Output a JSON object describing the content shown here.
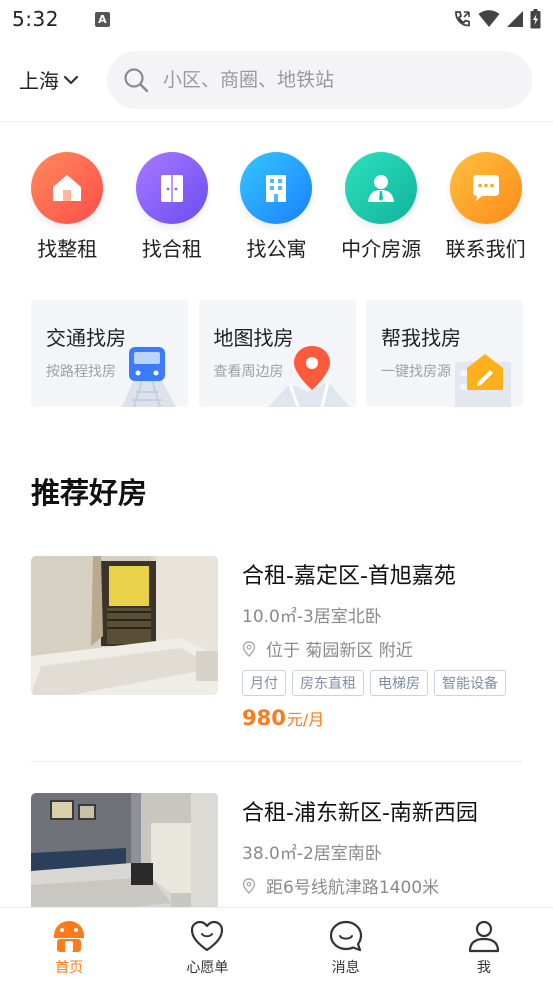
{
  "status": {
    "time": "5:32",
    "app_badge": "A"
  },
  "header": {
    "city": "上海",
    "search_placeholder": "小区、商圈、地铁站"
  },
  "categories": [
    {
      "label": "找整租",
      "icon": "house-icon",
      "color": "#ff5d4a"
    },
    {
      "label": "找合租",
      "icon": "door-icon",
      "color": "#8b5cf6"
    },
    {
      "label": "找公寓",
      "icon": "building-icon",
      "color": "#1aa3ff"
    },
    {
      "label": "中介房源",
      "icon": "agent-icon",
      "color": "#14c6a9"
    },
    {
      "label": "联系我们",
      "icon": "chat-bubble-icon",
      "color": "#ffa51a"
    }
  ],
  "finds": [
    {
      "title": "交通找房",
      "subtitle": "按路程找房",
      "icon": "train-icon"
    },
    {
      "title": "地图找房",
      "subtitle": "查看周边房",
      "icon": "map-pin-icon"
    },
    {
      "title": "帮我找房",
      "subtitle": "一键找房源",
      "icon": "edit-house-icon"
    }
  ],
  "section_title": "推荐好房",
  "listings": [
    {
      "title": "合租-嘉定区-首旭嘉苑",
      "spec": "10.0㎡-3居室北卧",
      "location": "位于 菊园新区 附近",
      "tags": [
        "月付",
        "房东直租",
        "电梯房",
        "智能设备"
      ],
      "price": "980",
      "price_unit": "元/月"
    },
    {
      "title": "合租-浦东新区-南新西园",
      "spec": "38.0㎡-2居室南卧",
      "location": "距6号线航津路1400米",
      "tags": [
        "",
        "",
        "",
        ""
      ]
    }
  ],
  "nav": [
    {
      "label": "首页",
      "icon": "home-icon",
      "active": true
    },
    {
      "label": "心愿单",
      "icon": "heart-icon",
      "active": false
    },
    {
      "label": "消息",
      "icon": "message-icon",
      "active": false
    },
    {
      "label": "我",
      "icon": "user-icon",
      "active": false
    }
  ],
  "colors": {
    "accent": "#ff7a1a",
    "tag_border": "#c9d4e3",
    "card_bg": "#f3f5f8"
  }
}
